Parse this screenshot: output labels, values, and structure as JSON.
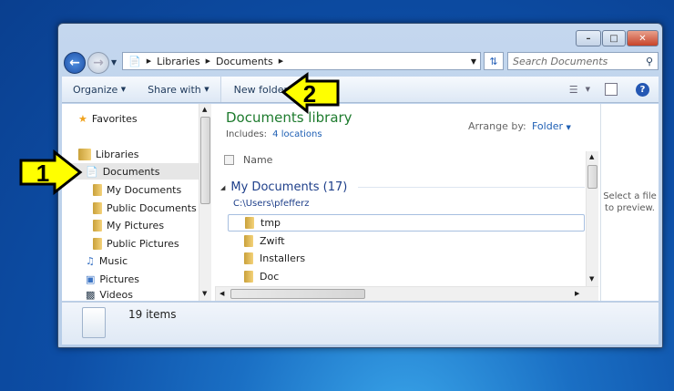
{
  "window": {
    "controls": [
      "minimize",
      "maximize",
      "close"
    ]
  },
  "address": {
    "crumbs": [
      "Libraries",
      "Documents"
    ],
    "search_placeholder": "Search Documents"
  },
  "toolbar": {
    "organize": "Organize",
    "share_with": "Share with",
    "new_folder": "New folder"
  },
  "nav": {
    "favorites": "Favorites",
    "libraries": "Libraries",
    "items": [
      {
        "label": "Documents",
        "level": 1,
        "selected": true
      },
      {
        "label": "My Documents",
        "level": 2
      },
      {
        "label": "Public Documents",
        "level": 2
      },
      {
        "label": "My Pictures",
        "level": 2
      },
      {
        "label": "Public Pictures",
        "level": 2
      },
      {
        "label": "Music",
        "level": 1
      },
      {
        "label": "Pictures",
        "level": 1
      },
      {
        "label": "Videos",
        "level": 1
      }
    ]
  },
  "content": {
    "title": "Documents library",
    "includes_label": "Includes:",
    "includes_link": "4 locations",
    "arrange_label": "Arrange by:",
    "arrange_value": "Folder",
    "column_name": "Name",
    "group": {
      "title": "My Documents (17)",
      "path": "C:\\Users\\pfefferz"
    },
    "rows": [
      "tmp",
      "Zwift",
      "Installers",
      "Doc"
    ]
  },
  "preview": {
    "text": "Select a file to preview."
  },
  "status": {
    "count": "19 items"
  },
  "annotations": {
    "arrow1": "1",
    "arrow2": "2",
    "color": "#ffff00"
  }
}
